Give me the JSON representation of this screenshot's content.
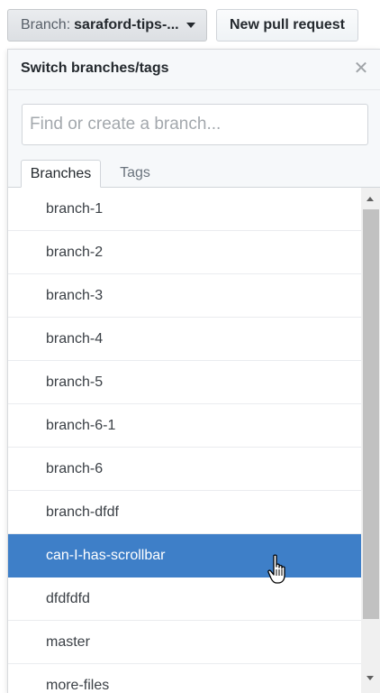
{
  "toolbar": {
    "branch_prefix": "Branch:",
    "branch_name": "saraford-tips-...",
    "new_pr_label": "New pull request"
  },
  "dropdown": {
    "title": "Switch branches/tags",
    "search_placeholder": "Find or create a branch...",
    "tabs": [
      {
        "label": "Branches",
        "active": true
      },
      {
        "label": "Tags",
        "active": false
      }
    ],
    "branches": [
      {
        "label": "branch-1"
      },
      {
        "label": "branch-2"
      },
      {
        "label": "branch-3"
      },
      {
        "label": "branch-4"
      },
      {
        "label": "branch-5"
      },
      {
        "label": "branch-6-1"
      },
      {
        "label": "branch-6"
      },
      {
        "label": "branch-dfdf"
      },
      {
        "label": "can-I-has-scrollbar",
        "selected": true
      },
      {
        "label": "dfdfdfd"
      },
      {
        "label": "master"
      },
      {
        "label": "more-files"
      }
    ]
  },
  "icons": {
    "close": "close-icon",
    "caret": "caret-down-icon",
    "cursor": "hand-pointer-icon"
  },
  "colors": {
    "selected_row": "#3e7fc8",
    "header_bg": "#f6f8fa"
  }
}
